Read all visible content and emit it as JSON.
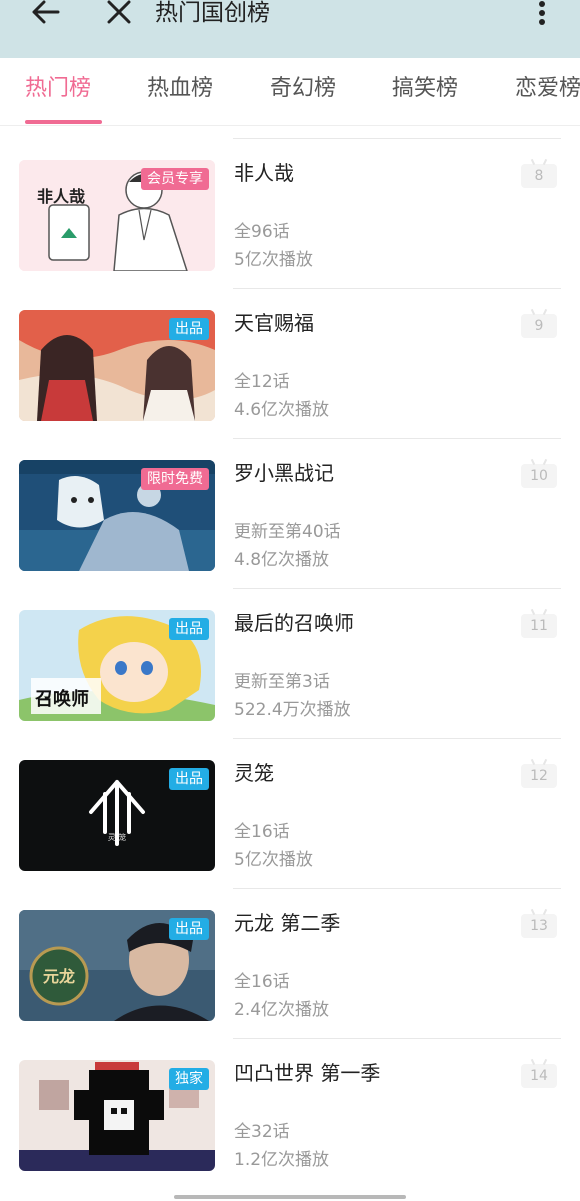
{
  "header": {
    "title": "热门国创榜",
    "back_icon": "arrow-left-icon",
    "close_icon": "close-icon",
    "more_icon": "more-vertical-icon"
  },
  "tabs": [
    {
      "label": "热门榜",
      "active": true
    },
    {
      "label": "热血榜",
      "active": false
    },
    {
      "label": "奇幻榜",
      "active": false
    },
    {
      "label": "搞笑榜",
      "active": false
    },
    {
      "label": "恋爱榜",
      "active": false
    }
  ],
  "colors": {
    "accent": "#f06b93",
    "header_bg": "#cfe3e6",
    "badge_blue": "#23ade5",
    "badge_pink": "#f06b93"
  },
  "items": [
    {
      "rank": "8",
      "title": "非人哉",
      "episodes": "全96话",
      "plays": "5亿次播放",
      "badge": "会员专享",
      "badge_color": "#f06b93",
      "thumb_text": "非人哉"
    },
    {
      "rank": "9",
      "title": "天官赐福",
      "episodes": "全12话",
      "plays": "4.6亿次播放",
      "badge": "出品",
      "badge_color": "#23ade5",
      "thumb_text": ""
    },
    {
      "rank": "10",
      "title": "罗小黑战记",
      "episodes": "更新至第40话",
      "plays": "4.8亿次播放",
      "badge": "限时免费",
      "badge_color": "#f06b93",
      "thumb_text": ""
    },
    {
      "rank": "11",
      "title": "最后的召唤师",
      "episodes": "更新至第3话",
      "plays": "522.4万次播放",
      "badge": "出品",
      "badge_color": "#23ade5",
      "thumb_text": "召唤师"
    },
    {
      "rank": "12",
      "title": "灵笼",
      "episodes": "全16话",
      "plays": "5亿次播放",
      "badge": "出品",
      "badge_color": "#23ade5",
      "thumb_text": "灵 笼"
    },
    {
      "rank": "13",
      "title": "元龙 第二季",
      "episodes": "全16话",
      "plays": "2.4亿次播放",
      "badge": "出品",
      "badge_color": "#23ade5",
      "thumb_text": "元龙"
    },
    {
      "rank": "14",
      "title": "凹凸世界 第一季",
      "episodes": "全32话",
      "plays": "1.2亿次播放",
      "badge": "独家",
      "badge_color": "#23ade5",
      "thumb_text": ""
    }
  ]
}
